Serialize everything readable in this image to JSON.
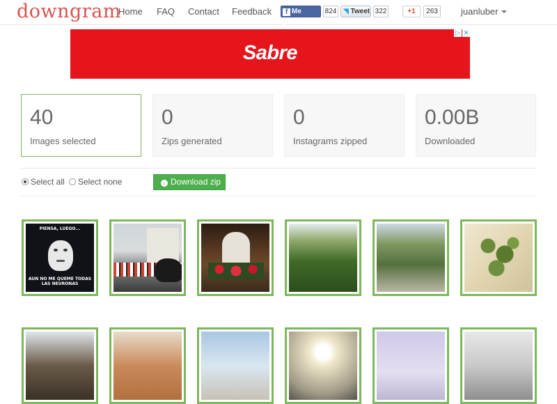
{
  "nav": {
    "brand": "downgram",
    "links": [
      "Home",
      "FAQ",
      "Contact",
      "Feedback"
    ],
    "user": "juanluber"
  },
  "social": {
    "facebook_label": "Me gusta",
    "facebook_count": "824",
    "twitter_label": "Tweet",
    "twitter_count": "322",
    "gplus_label": "+1",
    "gplus_count": "263"
  },
  "ad": {
    "logo": "Sabre",
    "background": "#e6141b",
    "info_icon": "▷",
    "close_icon": "✕"
  },
  "stats": [
    {
      "value": "40",
      "label": "Images selected"
    },
    {
      "value": "0",
      "label": "Zips generated"
    },
    {
      "value": "0",
      "label": "Instagrams zipped"
    },
    {
      "value": "0.00B",
      "label": "Downloaded"
    }
  ],
  "controls": {
    "select_all": "Select all",
    "select_none": "Select none",
    "download": "Download zip",
    "selected_option": "Select all"
  },
  "thumbnails": {
    "meme_top": "PIENSA, LUEGO...",
    "meme_bottom": "AUN NO ME QUEME TODAS LAS NEURONAS"
  },
  "colors": {
    "brand": "#d9534f",
    "accent_green": "#7bb85a",
    "button_green": "#4cae4c"
  }
}
